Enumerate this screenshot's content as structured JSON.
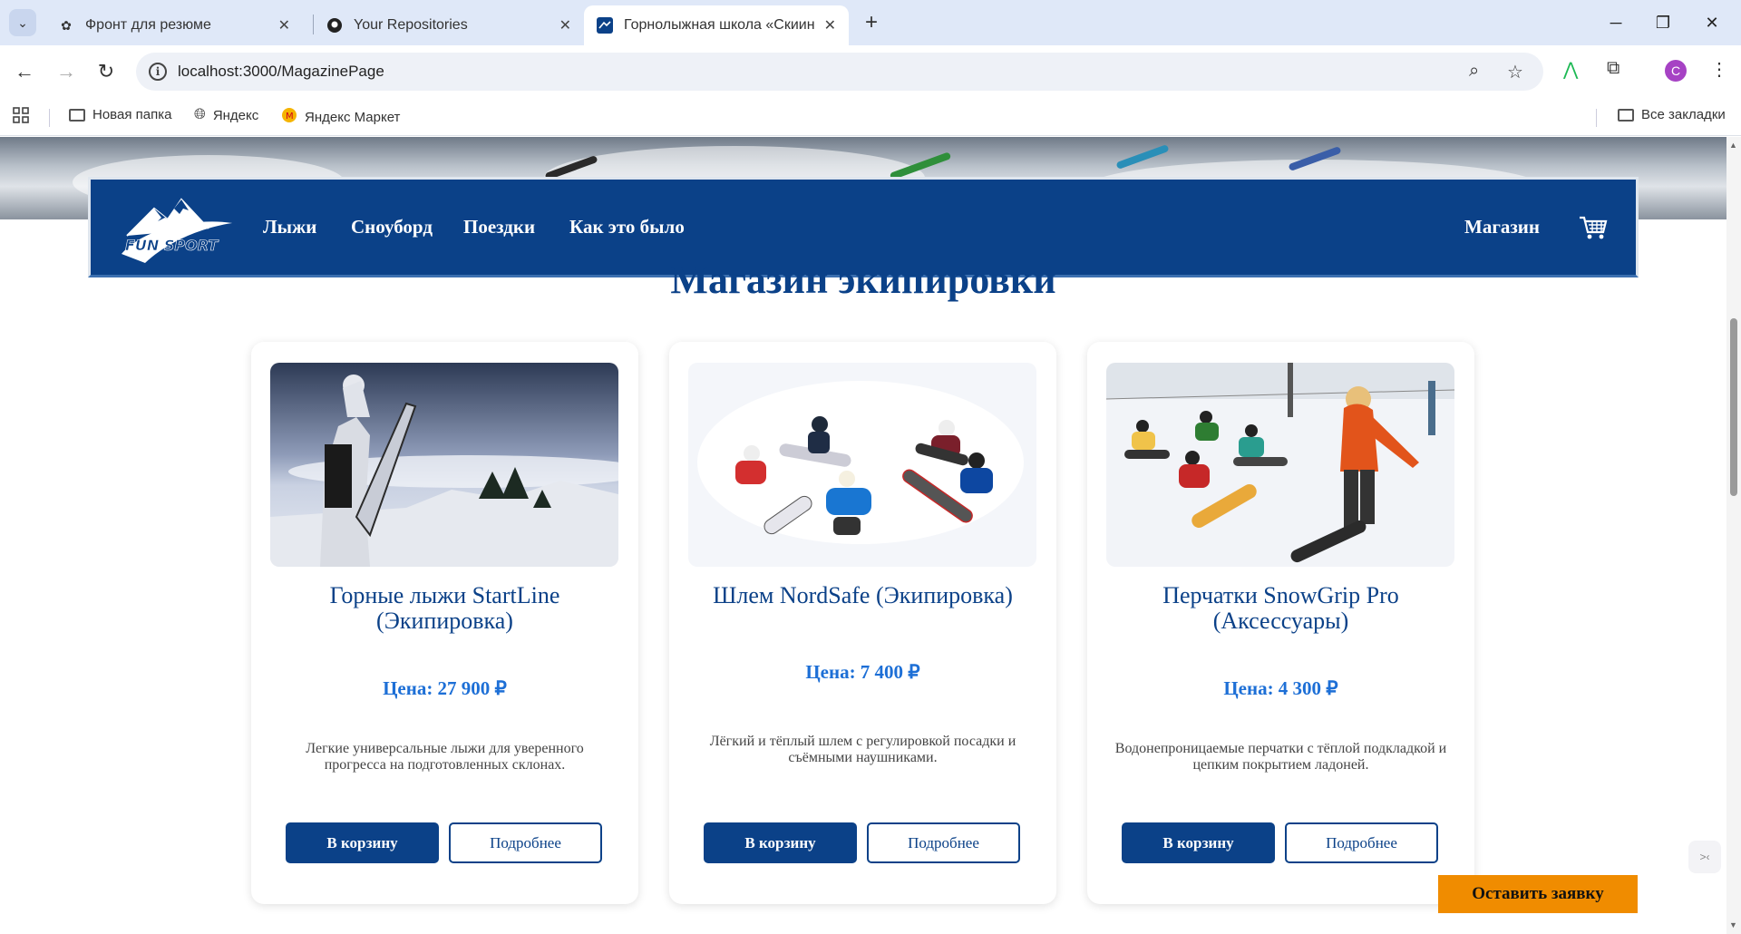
{
  "browser": {
    "tabs": [
      {
        "title": "Фронт для резюме",
        "icon": "chatgpt-icon"
      },
      {
        "title": "Your Repositories",
        "icon": "github-icon"
      },
      {
        "title": "Горнолыжная школа «Скиинг",
        "icon": "site-favicon",
        "active": true
      }
    ],
    "url": "localhost:3000/MagazinePage",
    "bookmarks": [
      {
        "label": "Новая папка",
        "icon": "folder-icon"
      },
      {
        "label": "Яндекс",
        "icon": "globe-icon"
      },
      {
        "label": "Яндекс Маркет",
        "icon": "yandex-market-icon"
      }
    ],
    "all_bookmarks": "Все закладки",
    "profile_initial": "C"
  },
  "site": {
    "logo_text": "FUN SPORT",
    "nav": [
      "Лыжи",
      "Сноуборд",
      "Поездки",
      "Как это было"
    ],
    "shop_link": "Магазин",
    "page_title": "Магазин экипировки",
    "products": [
      {
        "title": "Горные лыжи StartLine (Экипировка)",
        "price": "Цена: 27 900 ₽",
        "description": "Легкие универсальные лыжи для уверенного прогресса на подготовленных склонах.",
        "add_to_cart": "В корзину",
        "details": "Подробнее"
      },
      {
        "title": "Шлем NordSafe (Экипировка)",
        "price": "Цена: 7 400 ₽",
        "description": "Лёгкий и тёплый шлем с регулировкой посадки и съёмными наушниками.",
        "add_to_cart": "В корзину",
        "details": "Подробнее"
      },
      {
        "title": "Перчатки SnowGrip Pro (Аксессуары)",
        "price": "Цена: 4 300 ₽",
        "description": "Водонепроницаемые перчатки с тёплой подкладкой и цепким покрытием ладоней.",
        "add_to_cart": "В корзину",
        "details": "Подробнее"
      }
    ],
    "request_button": "Оставить заявку"
  },
  "colors": {
    "brand_blue": "#0b4188",
    "price_blue": "#1d6fd6",
    "accent_orange": "#f08c00"
  }
}
